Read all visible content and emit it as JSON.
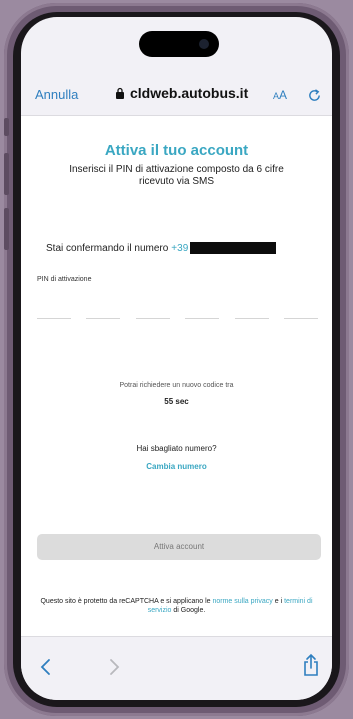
{
  "browser": {
    "cancel_label": "Annulla",
    "url": "cldweb.autobus.it",
    "text_size_label": "AA"
  },
  "form": {
    "title": "Attiva il tuo account",
    "subtitle": "Inserisci il PIN di attivazione composto da 6 cifre ricevuto via SMS",
    "confirm_text": "Stai confermando il numero",
    "phone_prefix": "+39",
    "pin_label": "PIN di attivazione",
    "pin_digits": 6,
    "resend_text": "Potrai richiedere un nuovo codice tra",
    "timer": "55 sec",
    "wrong_number_text": "Hai sbagliato numero?",
    "change_number_link": "Cambia numero",
    "activate_button": "Attiva account"
  },
  "recaptcha": {
    "part1": "Questo sito è protetto da reCAPTCHA e si applicano le",
    "privacy_link": "norme sulla privacy",
    "part2": "e i",
    "terms_link": "termini di servizio",
    "part3": "di Google."
  },
  "colors": {
    "accent": "#3aa7c2",
    "ios_blue": "#2f7fbf",
    "frame": "#6e5b73",
    "button_disabled": "#dcdcdc"
  }
}
